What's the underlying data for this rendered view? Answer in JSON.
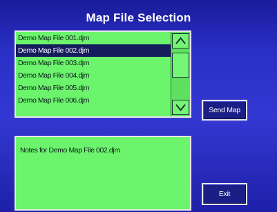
{
  "title": "Map File Selection",
  "file_list": {
    "items": [
      "Demo Map File 001.djm",
      "Demo Map File 002.djm",
      "Demo Map File 003.djm",
      "Demo Map File 004.djm",
      "Demo Map File 005.djm",
      "Demo Map File 006.djm"
    ],
    "selected_index": 1
  },
  "buttons": {
    "send_map": "Send Map",
    "exit": "Exit"
  },
  "notes": {
    "text": "Notes for Demo Map File 002.djm"
  },
  "colors": {
    "background": "#2a2fc8",
    "list_background": "#6cf46c",
    "selection": "#151c5c",
    "button": "#1a1f86"
  },
  "icons": {
    "scroll_up": "chevron-up-icon",
    "scroll_down": "chevron-down-icon"
  }
}
